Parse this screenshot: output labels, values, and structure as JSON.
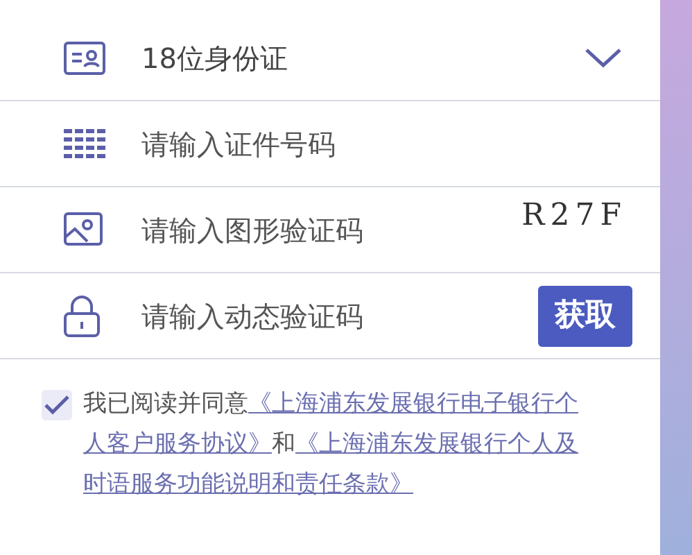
{
  "form": {
    "rows": [
      {
        "kind": "select",
        "value": "18位身份证"
      },
      {
        "kind": "input",
        "placeholder": "请输入证件号码"
      },
      {
        "kind": "captcha",
        "placeholder": "请输入图形验证码",
        "captcha": "R27F"
      },
      {
        "kind": "sms",
        "placeholder": "请输入动态验证码",
        "button": "获取"
      }
    ]
  },
  "agreement": {
    "checked": true,
    "parts": [
      {
        "kind": "text",
        "text": "我已阅读并同意"
      },
      {
        "kind": "link",
        "text": "《上海浦东发展银行电子银行个人客户服务协议》"
      },
      {
        "kind": "text",
        "text": "和"
      },
      {
        "kind": "link",
        "text": "《上海浦东发展银行个人及时语服务功能说明和责任条款》"
      }
    ]
  }
}
